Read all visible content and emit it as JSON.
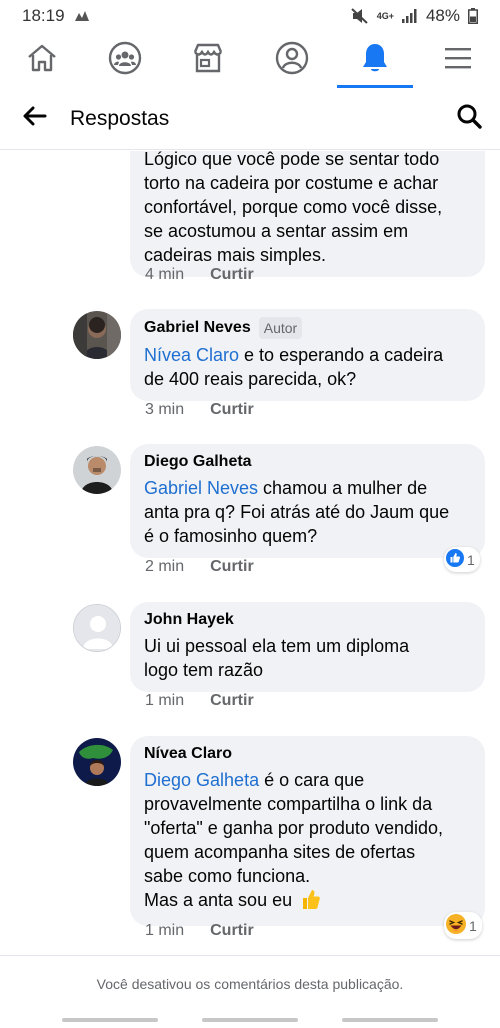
{
  "status_bar": {
    "time": "18:19",
    "signal_label": "4G+",
    "battery": "48%"
  },
  "header": {
    "title": "Respostas"
  },
  "comments": [
    {
      "author": "",
      "badge": "",
      "mention": "",
      "text_lines": [
        "Lógico que você pode se sentar todo",
        "torto na cadeira por costume e achar",
        "confortável, porque como você disse,",
        "se acostumou a sentar assim em",
        "cadeiras mais simples."
      ],
      "time": "4 min",
      "like_label": "Curtir"
    },
    {
      "author": "Gabriel Neves",
      "badge": "Autor",
      "mention": "Nívea Claro",
      "text_first_rest": " e to esperando a cadeira",
      "text_lines": [
        "de 400 reais parecida, ok?"
      ],
      "time": "3 min",
      "like_label": "Curtir"
    },
    {
      "author": "Diego Galheta",
      "badge": "",
      "mention": "Gabriel Neves",
      "text_first_rest": " chamou a mulher de",
      "text_lines": [
        "anta pra q? Foi atrás até do Jaum que",
        "é o famosinho quem?"
      ],
      "time": "2 min",
      "like_label": "Curtir",
      "reaction_count": "1",
      "reaction_icon": "like-icon"
    },
    {
      "author": "John Hayek",
      "badge": "",
      "mention": "",
      "text_lines": [
        "Ui ui pessoal ela tem um diploma",
        "logo tem razão"
      ],
      "time": "1 min",
      "like_label": "Curtir"
    },
    {
      "author": "Nívea Claro",
      "badge": "",
      "mention": "Diego Galheta",
      "text_first_rest": " é o cara que",
      "text_lines": [
        "provavelmente compartilha o link da",
        "\"oferta\" e ganha por produto vendido,",
        "quem acompanha sites de ofertas",
        "sabe como funciona.",
        "Mas a anta sou eu"
      ],
      "time": "1 min",
      "like_label": "Curtir",
      "reaction_count": "1",
      "reaction_icon": "haha-icon"
    }
  ],
  "footer": {
    "disabled_note": "Você desativou os comentários desta publicação."
  },
  "colors": {
    "accent": "#1877f2",
    "mention": "#1f6fd1",
    "bubble": "#f0f2f5",
    "meta": "#65676b"
  }
}
